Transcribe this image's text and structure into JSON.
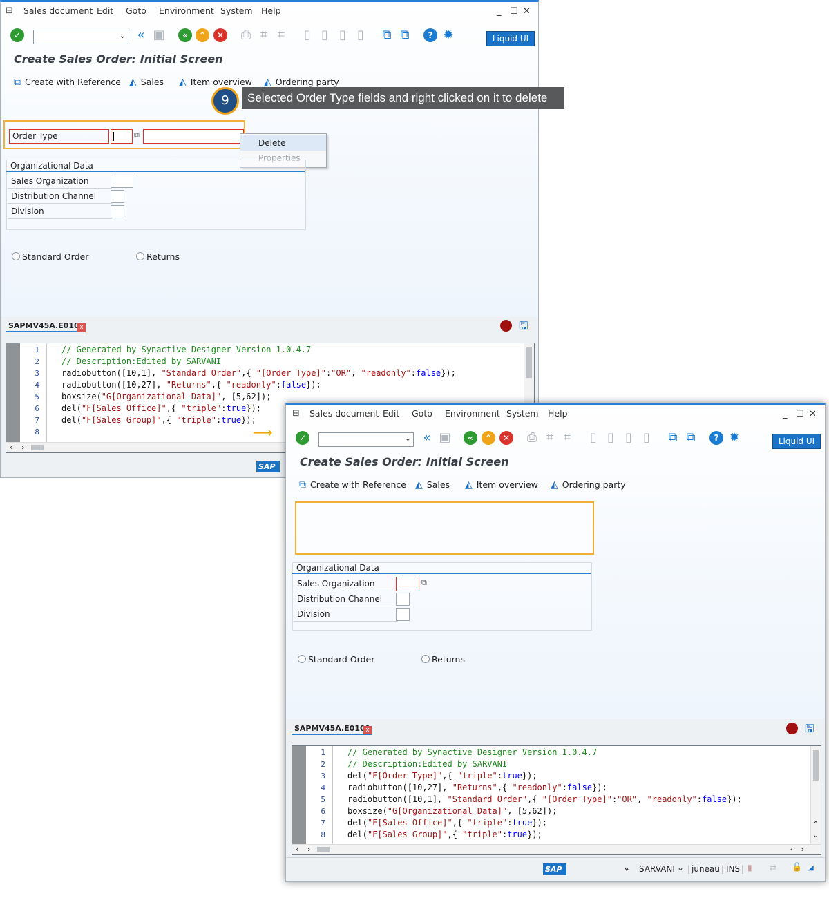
{
  "menu": [
    "Sales document",
    "Edit",
    "Goto",
    "Environment",
    "System",
    "Help"
  ],
  "win_controls": {
    "minimize": "_",
    "maximize": "☐",
    "close": "✕"
  },
  "toolbar": {
    "liquid_ui": "Liquid UI"
  },
  "screen_title": "Create Sales Order: Initial Screen",
  "app_toolbar": [
    "Create with Reference",
    "Sales",
    "Item overview",
    "Ordering party"
  ],
  "fields": {
    "order_type": "Order Type",
    "org_group": "Organizational Data",
    "sales_org": "Sales Organization",
    "dist_channel": "Distribution Channel",
    "division": "Division"
  },
  "radios": {
    "standard": "Standard Order",
    "returns": "Returns"
  },
  "context_menu": {
    "delete": "Delete",
    "properties": "Properties"
  },
  "annotation": {
    "step": "9",
    "text": "Selected Order Type fields and right clicked on it to delete"
  },
  "editor_tab": "SAPMV45A.E0101",
  "editor_close": "x",
  "code_before": [
    {
      "n": "1",
      "parts": [
        {
          "t": "// Generated by Synactive Designer Version 1.0.4.7",
          "c": "cm"
        }
      ]
    },
    {
      "n": "2",
      "parts": [
        {
          "t": "// Description:Edited by SARVANI",
          "c": "cm"
        }
      ]
    },
    {
      "n": "3",
      "parts": [
        {
          "t": "radiobutton([10,1], ",
          "c": ""
        },
        {
          "t": "\"Standard Order\"",
          "c": "st"
        },
        {
          "t": ",{ ",
          "c": ""
        },
        {
          "t": "\"[Order Type]\"",
          "c": "st"
        },
        {
          "t": ":",
          "c": ""
        },
        {
          "t": "\"OR\"",
          "c": "st"
        },
        {
          "t": ", ",
          "c": ""
        },
        {
          "t": "\"readonly\"",
          "c": "st"
        },
        {
          "t": ":",
          "c": ""
        },
        {
          "t": "false",
          "c": "kw"
        },
        {
          "t": "});",
          "c": ""
        }
      ]
    },
    {
      "n": "4",
      "parts": [
        {
          "t": "radiobutton([10,27], ",
          "c": ""
        },
        {
          "t": "\"Returns\"",
          "c": "st"
        },
        {
          "t": ",{ ",
          "c": ""
        },
        {
          "t": "\"readonly\"",
          "c": "st"
        },
        {
          "t": ":",
          "c": ""
        },
        {
          "t": "false",
          "c": "kw"
        },
        {
          "t": "});",
          "c": ""
        }
      ]
    },
    {
      "n": "5",
      "parts": [
        {
          "t": "boxsize(",
          "c": ""
        },
        {
          "t": "\"G[Organizational Data]\"",
          "c": "st"
        },
        {
          "t": ", [5,62]);",
          "c": ""
        }
      ]
    },
    {
      "n": "6",
      "parts": [
        {
          "t": "del(",
          "c": ""
        },
        {
          "t": "\"F[Sales Office]\"",
          "c": "st"
        },
        {
          "t": ",{ ",
          "c": ""
        },
        {
          "t": "\"triple\"",
          "c": "st"
        },
        {
          "t": ":",
          "c": ""
        },
        {
          "t": "true",
          "c": "kw"
        },
        {
          "t": "});",
          "c": ""
        }
      ]
    },
    {
      "n": "7",
      "parts": [
        {
          "t": "del(",
          "c": ""
        },
        {
          "t": "\"F[Sales Group]\"",
          "c": "st"
        },
        {
          "t": ",{ ",
          "c": ""
        },
        {
          "t": "\"triple\"",
          "c": "st"
        },
        {
          "t": ":",
          "c": ""
        },
        {
          "t": "true",
          "c": "kw"
        },
        {
          "t": "});",
          "c": ""
        }
      ]
    },
    {
      "n": "8",
      "parts": []
    }
  ],
  "code_after": [
    {
      "n": "1",
      "parts": [
        {
          "t": "// Generated by Synactive Designer Version 1.0.4.7",
          "c": "cm"
        }
      ]
    },
    {
      "n": "2",
      "parts": [
        {
          "t": "// Description:Edited by SARVANI",
          "c": "cm"
        }
      ]
    },
    {
      "n": "3",
      "parts": [
        {
          "t": "del(",
          "c": ""
        },
        {
          "t": "\"F[Order Type]\"",
          "c": "st"
        },
        {
          "t": ",{ ",
          "c": ""
        },
        {
          "t": "\"triple\"",
          "c": "st"
        },
        {
          "t": ":",
          "c": ""
        },
        {
          "t": "true",
          "c": "kw"
        },
        {
          "t": "});",
          "c": ""
        }
      ]
    },
    {
      "n": "4",
      "parts": [
        {
          "t": "radiobutton([10,27], ",
          "c": ""
        },
        {
          "t": "\"Returns\"",
          "c": "st"
        },
        {
          "t": ",{ ",
          "c": ""
        },
        {
          "t": "\"readonly\"",
          "c": "st"
        },
        {
          "t": ":",
          "c": ""
        },
        {
          "t": "false",
          "c": "kw"
        },
        {
          "t": "});",
          "c": ""
        }
      ]
    },
    {
      "n": "5",
      "parts": [
        {
          "t": "radiobutton([10,1], ",
          "c": ""
        },
        {
          "t": "\"Standard Order\"",
          "c": "st"
        },
        {
          "t": ",{ ",
          "c": ""
        },
        {
          "t": "\"[Order Type]\"",
          "c": "st"
        },
        {
          "t": ":",
          "c": ""
        },
        {
          "t": "\"OR\"",
          "c": "st"
        },
        {
          "t": ", ",
          "c": ""
        },
        {
          "t": "\"readonly\"",
          "c": "st"
        },
        {
          "t": ":",
          "c": ""
        },
        {
          "t": "false",
          "c": "kw"
        },
        {
          "t": "});",
          "c": ""
        }
      ]
    },
    {
      "n": "6",
      "parts": [
        {
          "t": "boxsize(",
          "c": ""
        },
        {
          "t": "\"G[Organizational Data]\"",
          "c": "st"
        },
        {
          "t": ", [5,62]);",
          "c": ""
        }
      ]
    },
    {
      "n": "7",
      "parts": [
        {
          "t": "del(",
          "c": ""
        },
        {
          "t": "\"F[Sales Office]\"",
          "c": "st"
        },
        {
          "t": ",{ ",
          "c": ""
        },
        {
          "t": "\"triple\"",
          "c": "st"
        },
        {
          "t": ":",
          "c": ""
        },
        {
          "t": "true",
          "c": "kw"
        },
        {
          "t": "});",
          "c": ""
        }
      ]
    },
    {
      "n": "8",
      "parts": [
        {
          "t": "del(",
          "c": ""
        },
        {
          "t": "\"F[Sales Group]\"",
          "c": "st"
        },
        {
          "t": ",{ ",
          "c": ""
        },
        {
          "t": "\"triple\"",
          "c": "st"
        },
        {
          "t": ":",
          "c": ""
        },
        {
          "t": "true",
          "c": "kw"
        },
        {
          "t": "});",
          "c": ""
        }
      ]
    }
  ],
  "statusbar": {
    "sap_logo": "SAP",
    "nav": "»",
    "user": "SARVANI",
    "user_dd": "⌄",
    "server": "juneau",
    "mode": "INS"
  }
}
